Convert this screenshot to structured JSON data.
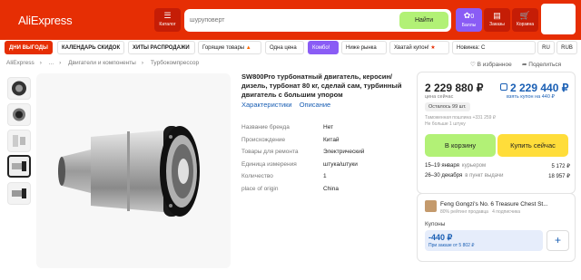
{
  "header": {
    "logo": "AliExpress",
    "catalog_label": "Каталог",
    "search_placeholder": "шуруповерт",
    "search_button": "Найти",
    "balls_count": "0",
    "balls_label": "Баллы",
    "orders_label": "Заказы",
    "cart_label": "Корзина"
  },
  "categories": [
    {
      "label": "ДНИ ВЫГОДЫ",
      "style": "red"
    },
    {
      "label": "КАЛЕНДАРЬ СКИДОК",
      "style": "bold"
    },
    {
      "label": "ХИТЫ РАСПРОДАЖИ",
      "style": "bold"
    },
    {
      "label": "Горящие товары",
      "style": "plain"
    },
    {
      "label": "Одна цена",
      "style": "plain"
    },
    {
      "label": "Комбо!",
      "style": "purple"
    },
    {
      "label": "Ниже рынка",
      "style": "plain"
    },
    {
      "label": "Хватай купон!",
      "style": "plain"
    },
    {
      "label": "Новинка: С",
      "style": "plain"
    },
    {
      "label": "RU",
      "style": "plain"
    },
    {
      "label": "RUB",
      "style": "plain"
    }
  ],
  "breadcrumbs": [
    "AliExpress",
    "...",
    "Двигатели и компоненты",
    "Турбокомпрессор"
  ],
  "favorite_label": "В избранное",
  "share_label": "Поделиться",
  "product": {
    "title": "SW800Pro турбонатный двигатель, керосин/дизель, турбонат 80 кг, сделай сам, турбинный двигатель с большим упором",
    "link_characteristics": "Характеристики",
    "link_description": "Описание",
    "specs": [
      {
        "key": "Название бренда",
        "value": "Нет"
      },
      {
        "key": "Происхождение",
        "value": "Китай"
      },
      {
        "key": "Товары для ремонта",
        "value": "Электрический"
      },
      {
        "key": "Единица измерения",
        "value": "штука/штуки"
      },
      {
        "key": "Количество",
        "value": "1"
      },
      {
        "key": "place of origin",
        "value": "China"
      }
    ]
  },
  "price": {
    "now": "2 229 880 ₽",
    "now_label": "цена сейчас",
    "coupon_price": "2 229 440 ₽",
    "coupon_label": "взять купон на 440 ₽",
    "stock": "Осталось 99 шт.",
    "customs": "Таможенная пошлина +331 259 ₽",
    "customs_note": "Не больше 1 штуку",
    "add_to_cart": "В корзину",
    "buy_now": "Купить сейчас",
    "shipping": [
      {
        "dates": "15–19 января",
        "method": "курьером",
        "price": "5 172 ₽"
      },
      {
        "dates": "26–30 декабря",
        "method": "в пункт выдачи",
        "price": "18 957 ₽"
      }
    ]
  },
  "seller": {
    "name": "Feng Gongzi's No. 6 Treasure Chest St...",
    "rating": "80% рейтинг продавца",
    "subscribers": "4 подписчика",
    "coupons_title": "Купоны",
    "coupon_amount": "-440 ₽",
    "coupon_condition": "При заказе от 5 802 ₽"
  },
  "colors": {
    "brand_red": "#e62e04",
    "green_button": "#b2f176",
    "yellow_button": "#ffdd3a",
    "link_blue": "#1a5fb4",
    "balls_purple": "#8a5cf5"
  }
}
